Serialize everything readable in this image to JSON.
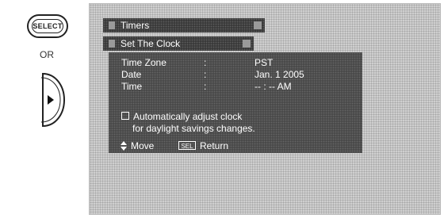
{
  "remote": {
    "select_button_label": "SELECT",
    "or_label": "OR",
    "right_arrow_icon": "triangle-right-icon"
  },
  "menu": {
    "timers_title": "Timers",
    "clock_title": "Set The Clock",
    "rows": [
      {
        "label": "Time Zone",
        "colon": ":",
        "value": "PST"
      },
      {
        "label": "Date",
        "colon": ":",
        "value": "Jan. 1 2005"
      },
      {
        "label": "Time",
        "colon": ":",
        "value": "-- : -- AM"
      }
    ],
    "auto_adjust_line1": "Automatically adjust clock",
    "auto_adjust_line2": "for daylight savings changes.",
    "auto_adjust_checked": false
  },
  "footer": {
    "move_icon": "up-down-arrows-icon",
    "move_label": "Move",
    "sel_icon_label": "SEL",
    "return_label": "Return"
  }
}
